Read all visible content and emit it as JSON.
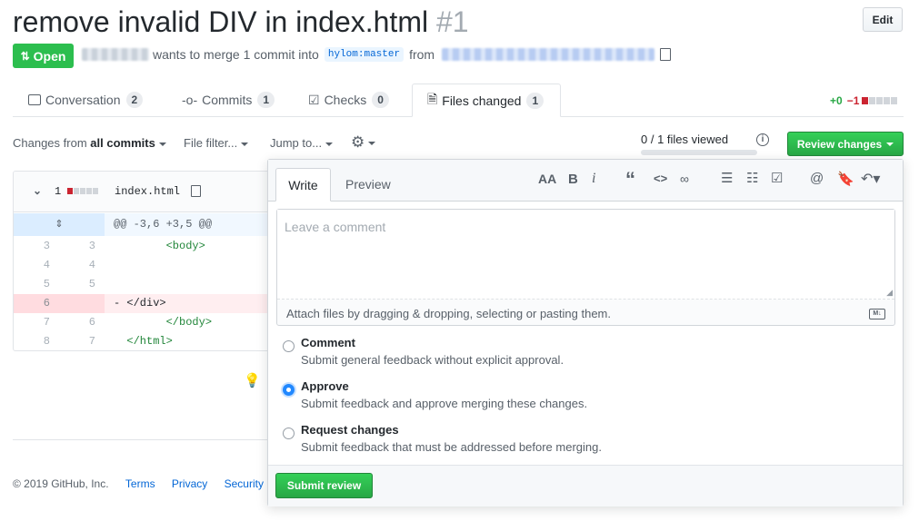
{
  "pr": {
    "title": "remove invalid DIV in index.html",
    "number": "#1",
    "edit_label": "Edit",
    "state_label": "Open",
    "merge_text": "wants to merge 1 commit into",
    "base_branch": "hylom:master",
    "from_text": "from"
  },
  "tabs": [
    {
      "label": "Conversation",
      "count": "2"
    },
    {
      "label": "Commits",
      "count": "1"
    },
    {
      "label": "Checks",
      "count": "0"
    },
    {
      "label": "Files changed",
      "count": "1"
    }
  ],
  "diffstat": {
    "added": "+0",
    "removed": "−1"
  },
  "toolbar": {
    "changes_from_prefix": "Changes from",
    "changes_from_value": "all commits",
    "file_filter": "File filter...",
    "jump_to": "Jump to...",
    "files_viewed": "0 / 1 files viewed",
    "review_changes": "Review changes"
  },
  "file": {
    "count": "1",
    "name": "index.html",
    "hunk": "@@ -3,6 +3,5 @@",
    "lines": [
      {
        "old": "3",
        "new": "3",
        "code": "        <body>",
        "type": "context"
      },
      {
        "old": "4",
        "new": "4",
        "code": "",
        "type": "context"
      },
      {
        "old": "5",
        "new": "5",
        "code": "",
        "type": "context"
      },
      {
        "old": "6",
        "new": "",
        "code": "- </div>",
        "type": "removed"
      },
      {
        "old": "7",
        "new": "6",
        "code": "        </body>",
        "type": "context"
      },
      {
        "old": "8",
        "new": "7",
        "code": "  </html>",
        "type": "context"
      }
    ]
  },
  "review": {
    "tab_write": "Write",
    "tab_preview": "Preview",
    "placeholder": "Leave a comment",
    "attach_text": "Attach files by dragging & dropping, selecting or pasting them.",
    "options": [
      {
        "label": "Comment",
        "desc": "Submit general feedback without explicit approval.",
        "selected": false
      },
      {
        "label": "Approve",
        "desc": "Submit feedback and approve merging these changes.",
        "selected": true
      },
      {
        "label": "Request changes",
        "desc": "Submit feedback that must be addressed before merging.",
        "selected": false
      }
    ],
    "submit": "Submit review"
  },
  "footer": {
    "copyright": "© 2019 GitHub, Inc.",
    "links": [
      "Terms",
      "Privacy",
      "Security"
    ]
  },
  "colors": {
    "open_green": "#2cbe4e",
    "review_green": "#28a745",
    "link_blue": "#0366d6",
    "removed_bg": "#ffeef0",
    "hunk_bg": "#f1f8ff"
  }
}
